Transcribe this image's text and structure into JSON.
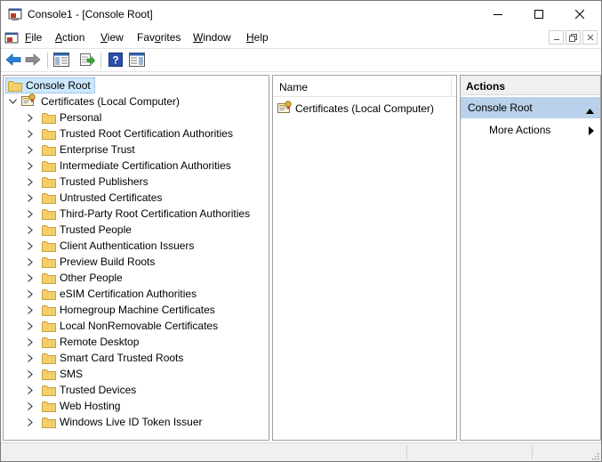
{
  "window": {
    "title": "Console1 - [Console Root]"
  },
  "menu": {
    "items": [
      {
        "label": "File",
        "mnemonic": "F",
        "rest": "ile"
      },
      {
        "label": "Action",
        "mnemonic": "A",
        "rest": "ction"
      },
      {
        "label": "View",
        "mnemonic": "V",
        "rest": "iew"
      },
      {
        "label": "Favorites",
        "pre": "Fav",
        "mnemonic": "o",
        "rest": "rites"
      },
      {
        "label": "Window",
        "mnemonic": "W",
        "rest": "indow"
      },
      {
        "label": "Help",
        "mnemonic": "H",
        "rest": "elp"
      }
    ]
  },
  "toolbar": {
    "buttons": [
      "back-icon",
      "forward-icon",
      "show-hide-tree-icon",
      "export-list-icon",
      "help-icon",
      "show-hide-action-pane-icon"
    ]
  },
  "tree": {
    "root": "Console Root",
    "computer_node": "Certificates (Local Computer)",
    "stores": [
      "Personal",
      "Trusted Root Certification Authorities",
      "Enterprise Trust",
      "Intermediate Certification Authorities",
      "Trusted Publishers",
      "Untrusted Certificates",
      "Third-Party Root Certification Authorities",
      "Trusted People",
      "Client Authentication Issuers",
      "Preview Build Roots",
      "Other People",
      "eSIM Certification Authorities",
      "Homegroup Machine Certificates",
      "Local NonRemovable Certificates",
      "Remote Desktop",
      "Smart Card Trusted Roots",
      "SMS",
      "Trusted Devices",
      "Web Hosting",
      "Windows Live ID Token Issuer"
    ]
  },
  "list": {
    "column_name": "Name",
    "items": [
      "Certificates (Local Computer)"
    ]
  },
  "actions": {
    "header": "Actions",
    "section": "Console Root",
    "more": "More Actions"
  },
  "colors": {
    "selection_bg": "#cce8ff",
    "actions_section_bg": "#b9d1ea",
    "folder_yellow": "#f3cf6b"
  }
}
